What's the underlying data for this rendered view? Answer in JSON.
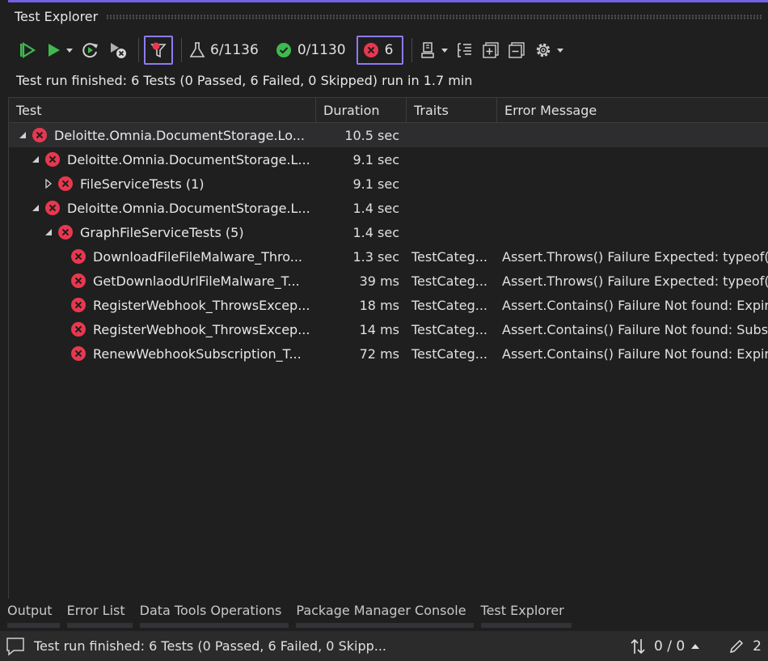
{
  "window": {
    "title": "Test Explorer"
  },
  "toolbar": {
    "total_label": "6/1136",
    "passed_label": "0/1130",
    "failed_label": "6"
  },
  "status_message": "Test run finished: 6 Tests (0 Passed, 6 Failed, 0 Skipped) run in 1.7 min",
  "grid": {
    "headers": {
      "test": "Test",
      "duration": "Duration",
      "traits": "Traits",
      "error": "Error Message"
    },
    "rows": [
      {
        "name": "Deloitte.Omnia.DocumentStorage.Lo...",
        "duration": "10.5 sec",
        "traits": "",
        "error": "",
        "expanded": true
      },
      {
        "name": "Deloitte.Omnia.DocumentStorage.L...",
        "duration": "9.1 sec",
        "traits": "",
        "error": "",
        "expanded": true
      },
      {
        "name": "FileServiceTests  (1)",
        "duration": "9.1 sec",
        "traits": "",
        "error": "",
        "expanded": false
      },
      {
        "name": "Deloitte.Omnia.DocumentStorage.L...",
        "duration": "1.4 sec",
        "traits": "",
        "error": "",
        "expanded": true
      },
      {
        "name": "GraphFileServiceTests  (5)",
        "duration": "1.4 sec",
        "traits": "",
        "error": "",
        "expanded": true
      },
      {
        "name": "DownloadFileFileMalware_Thro...",
        "duration": "1.3 sec",
        "traits": "TestCateg...",
        "error": "Assert.Throws() Failure Expected: typeof(D"
      },
      {
        "name": "GetDownlaodUrlFileMalware_T...",
        "duration": "39 ms",
        "traits": "TestCateg...",
        "error": "Assert.Throws() Failure Expected: typeof(D"
      },
      {
        "name": "RegisterWebhook_ThrowsExcep...",
        "duration": "18 ms",
        "traits": "TestCateg...",
        "error": "Assert.Contains() Failure Not found: Expira"
      },
      {
        "name": "RegisterWebhook_ThrowsExcep...",
        "duration": "14 ms",
        "traits": "TestCateg...",
        "error": "Assert.Contains() Failure Not found: Subsc"
      },
      {
        "name": "RenewWebhookSubscription_T...",
        "duration": "72 ms",
        "traits": "TestCateg...",
        "error": "Assert.Contains() Failure Not found: Expira"
      }
    ]
  },
  "bottom_tabs": [
    {
      "label": "Output"
    },
    {
      "label": "Error List"
    },
    {
      "label": "Data Tools Operations"
    },
    {
      "label": "Package Manager Console"
    },
    {
      "label": "Test Explorer"
    }
  ],
  "statusbar": {
    "message": "Test run finished: 6 Tests (0 Passed, 6 Failed, 0 Skipp...",
    "changes": "0 / 0",
    "edits": "2"
  },
  "colors": {
    "accent": "#7160e8",
    "fail": "#e8384f",
    "pass": "#3fb950",
    "run": "#3fb950"
  }
}
